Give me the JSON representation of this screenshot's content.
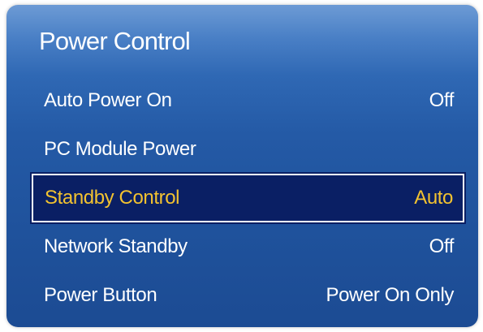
{
  "menu": {
    "title": "Power Control",
    "items": [
      {
        "label": "Auto Power On",
        "value": "Off",
        "selected": false
      },
      {
        "label": "PC Module Power",
        "value": "",
        "selected": false
      },
      {
        "label": "Standby Control",
        "value": "Auto",
        "selected": true
      },
      {
        "label": "Network Standby",
        "value": "Off",
        "selected": false
      },
      {
        "label": "Power Button",
        "value": "Power On Only",
        "selected": false
      }
    ]
  },
  "colors": {
    "panel_top": "#6d9bd5",
    "panel_bottom": "#1c4b93",
    "selected_bg": "#0a1f64",
    "selected_text": "#f2c230",
    "text": "#ffffff"
  }
}
